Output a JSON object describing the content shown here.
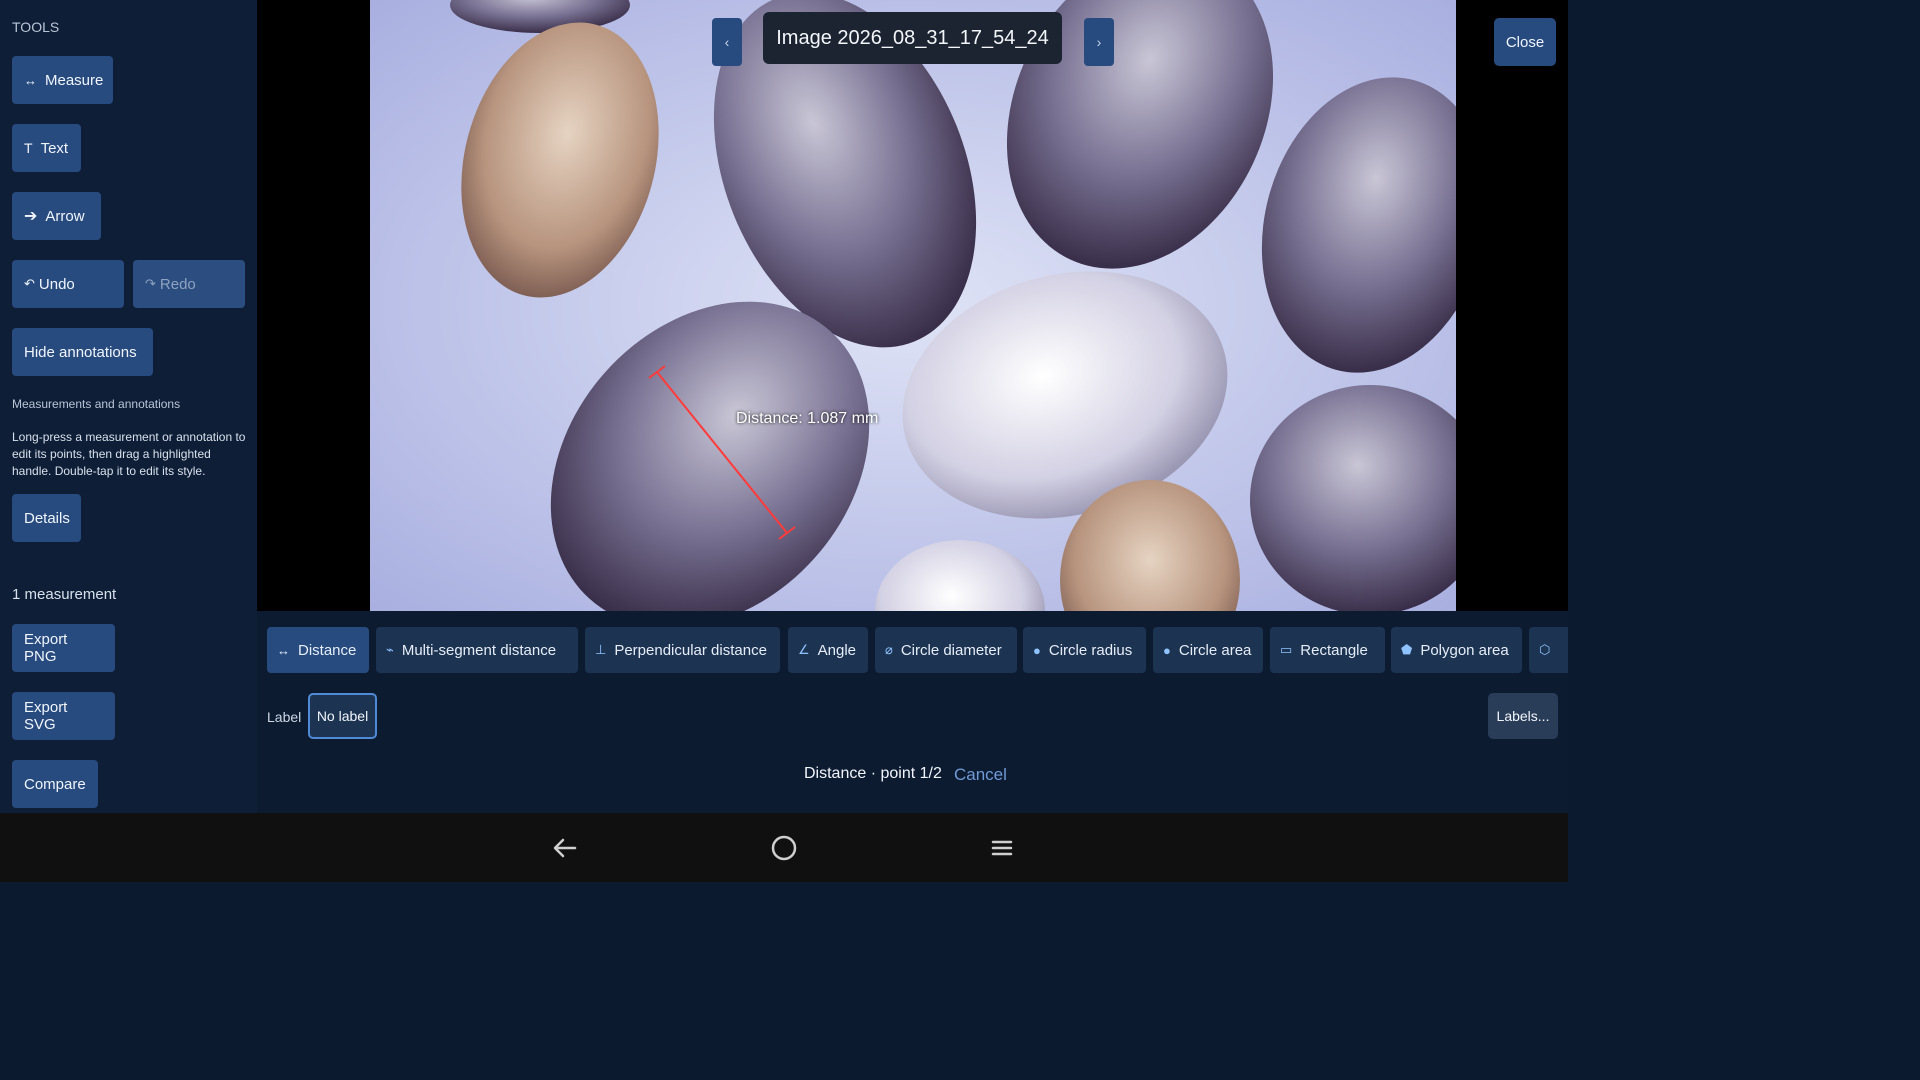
{
  "sidebar": {
    "heading": "TOOLS",
    "measure_label": "Measure",
    "text_label": "Text",
    "arrow_label": "Arrow",
    "undo_label": "Undo",
    "redo_label": "Redo",
    "hide_annotations_label": "Hide annotations",
    "section_title": "Measurements and annotations",
    "help_text": "Long-press a measurement or annotation to edit its points, then drag a highlighted handle. Double-tap it to edit its style.",
    "details_label": "Details",
    "measurement_count": "1 measurement",
    "export_png_label": "Export PNG",
    "export_svg_label": "Export SVG",
    "compare_label": "Compare"
  },
  "viewer": {
    "image_title": "Image 2026_08_31_17_54_24",
    "prev_arrow": "‹",
    "next_arrow": "›",
    "close_label": "Close",
    "measurement_label": "Distance: 1.087 mm",
    "measure_line_color": "#ff3b3b"
  },
  "toolbar": {
    "tools": [
      {
        "label": "Distance",
        "icon": "distance-icon",
        "active": true
      },
      {
        "label": "Multi-segment distance",
        "icon": "multi-segment-icon"
      },
      {
        "label": "Perpendicular distance",
        "icon": "perpendicular-icon"
      },
      {
        "label": "Angle",
        "icon": "angle-icon"
      },
      {
        "label": "Circle diameter",
        "icon": "circle-diameter-icon"
      },
      {
        "label": "Circle radius",
        "icon": "circle-radius-icon"
      },
      {
        "label": "Circle area",
        "icon": "circle-area-icon"
      },
      {
        "label": "Rectangle",
        "icon": "rectangle-icon"
      },
      {
        "label": "Polygon area",
        "icon": "polygon-icon"
      }
    ],
    "label_text": "Label",
    "no_label": "No label",
    "labels_button": "Labels..."
  },
  "status": {
    "text": "Distance · point 1/2",
    "cancel_label": "Cancel"
  },
  "colors": {
    "accent": "#274b7e",
    "background": "#0b1a2e"
  }
}
